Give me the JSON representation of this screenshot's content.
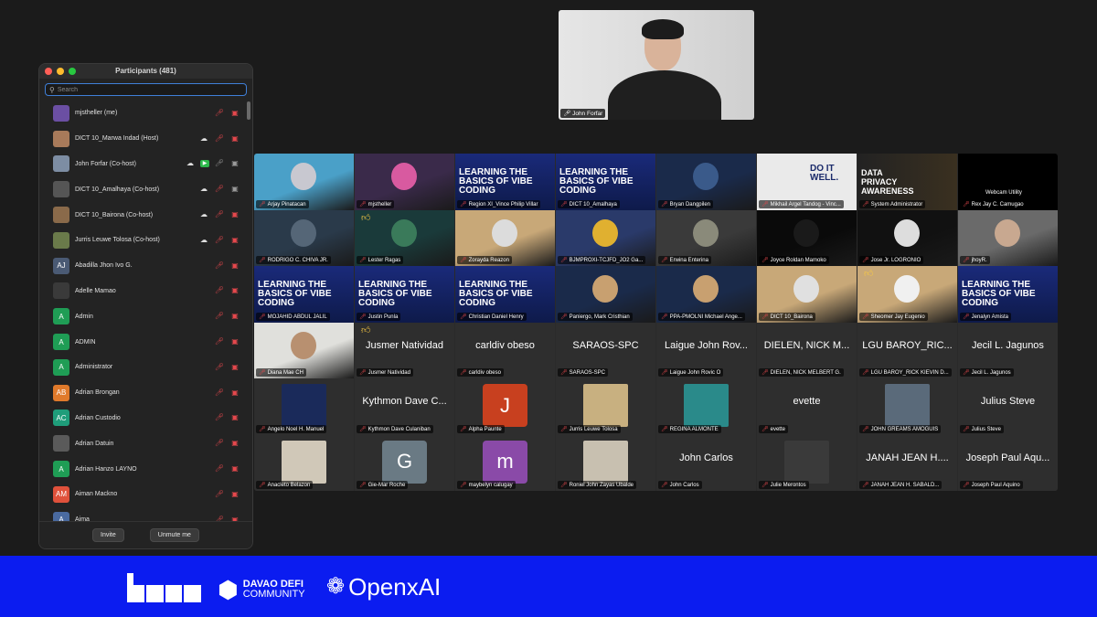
{
  "participants_panel": {
    "title": "Participants (481)",
    "search_placeholder": "Search",
    "items": [
      {
        "name": "mjstheller (me)",
        "avatar": "",
        "avatar_color": "#6b4fa3",
        "icons": [
          "mic-off-icon",
          "video-off-icon"
        ]
      },
      {
        "name": "DICT 10_Marwa Indad (Host)",
        "avatar": "",
        "avatar_color": "#a87a5a",
        "icons": [
          "cloud-icon",
          "mic-off-icon",
          "video-off-icon"
        ]
      },
      {
        "name": "John Forfar (Co-host)",
        "avatar": "",
        "avatar_color": "#7d8da3",
        "icons": [
          "cloud-icon",
          "screen-share-icon",
          "mic-icon",
          "video-icon"
        ]
      },
      {
        "name": "DICT 10_Amalhaya (Co-host)",
        "avatar": "",
        "avatar_color": "#555555",
        "icons": [
          "cloud-icon",
          "mic-off-icon",
          "video-icon"
        ]
      },
      {
        "name": "DICT 10_Bairona (Co-host)",
        "avatar": "",
        "avatar_color": "#8a6a4a",
        "icons": [
          "cloud-icon",
          "mic-off-icon",
          "video-off-icon"
        ]
      },
      {
        "name": "Jurris Leuwe Tolosa (Co-host)",
        "avatar": "",
        "avatar_color": "#6a7a4a",
        "icons": [
          "cloud-icon",
          "mic-off-icon",
          "video-off-icon"
        ]
      },
      {
        "name": "Abadilla Jhon Ivo G.",
        "avatar": "AJ",
        "avatar_color": "#4a5a74",
        "icons": [
          "mic-off-icon",
          "video-off-icon"
        ]
      },
      {
        "name": "Adelle Mamao",
        "avatar": "",
        "avatar_color": "#3a3a3a",
        "icons": [
          "mic-off-icon",
          "video-off-icon"
        ]
      },
      {
        "name": "Admin",
        "avatar": "A",
        "avatar_color": "#1f9d55",
        "icons": [
          "mic-off-icon",
          "video-off-icon"
        ]
      },
      {
        "name": "ADMIN",
        "avatar": "A",
        "avatar_color": "#1f9d55",
        "icons": [
          "mic-off-icon",
          "video-off-icon"
        ]
      },
      {
        "name": "Administrator",
        "avatar": "A",
        "avatar_color": "#1f9d55",
        "icons": [
          "mic-off-icon",
          "video-off-icon"
        ]
      },
      {
        "name": "Adrian Brongan",
        "avatar": "AB",
        "avatar_color": "#e07a2b",
        "icons": [
          "mic-off-icon",
          "video-off-icon"
        ]
      },
      {
        "name": "Adrian Custodio",
        "avatar": "AC",
        "avatar_color": "#1f9d7a",
        "icons": [
          "mic-off-icon",
          "video-off-icon"
        ]
      },
      {
        "name": "Adrian Datuin",
        "avatar": "",
        "avatar_color": "#5a5a5a",
        "icons": [
          "mic-off-icon",
          "video-off-icon"
        ]
      },
      {
        "name": "Adrian Hanzo LAYNO",
        "avatar": "A",
        "avatar_color": "#1f9d55",
        "icons": [
          "mic-off-icon",
          "video-off-icon"
        ]
      },
      {
        "name": "Aiman Mackno",
        "avatar": "AM",
        "avatar_color": "#e0513b",
        "icons": [
          "mic-off-icon",
          "video-off-icon"
        ]
      },
      {
        "name": "Aima",
        "avatar": "A",
        "avatar_color": "#4a6aa0",
        "icons": [
          "mic-off-icon",
          "video-off-icon"
        ]
      }
    ],
    "invite_label": "Invite",
    "unmute_label": "Unmute me"
  },
  "speaker": {
    "name": "John Forfar"
  },
  "gallery": [
    {
      "label": "Arjay Pinatacan",
      "style": "photo",
      "bg": "#4aa0c8",
      "accent": "#c8c8d0"
    },
    {
      "label": "mjstheller",
      "style": "photo",
      "bg": "#3a2a4a",
      "accent": "#d85aa0"
    },
    {
      "label": "Region XI_Vince Philip Villar",
      "style": "slide",
      "title": "LEARNING THE BASICS OF VIBE CODING"
    },
    {
      "label": "DICT 10_Amalhaya",
      "style": "slide",
      "title": "LEARNING THE BASICS OF VIBE CODING"
    },
    {
      "label": "Bryan Dangpilen",
      "style": "photo",
      "bg": "#1a2a4a",
      "accent": "#3a5a8a"
    },
    {
      "label": "Mikhail Argel Tandog - Vinc...",
      "style": "do",
      "title": "DO IT WELL."
    },
    {
      "label": "System Administrator",
      "style": "privacy",
      "title": "DATA PRIVACY AWARENESS"
    },
    {
      "label": "Rex Jay C. Camugao",
      "style": "webcam",
      "title": "Webcam Utility"
    },
    {
      "label": "RODRIGO C. CHIVA JR.",
      "style": "photo",
      "bg": "#2a3a4a",
      "accent": "#556677"
    },
    {
      "label": "Lester Ragas",
      "style": "photo",
      "bg": "#1a3a3a",
      "accent": "#3a7a5a",
      "thumb": true
    },
    {
      "label": "Zorayda Reazon",
      "style": "photo",
      "bg": "#c8a878",
      "accent": "#dcdcdc"
    },
    {
      "label": "BJMPROXI-TCJFD_JO2 Ga...",
      "style": "photo",
      "bg": "#2a3a6a",
      "accent": "#e0b030"
    },
    {
      "label": "Erwina Enterina",
      "style": "photo",
      "bg": "#3a3a3a",
      "accent": "#8a8a7a"
    },
    {
      "label": "Joyce Roldan Mamoko",
      "style": "photo",
      "bg": "#0a0a0a",
      "accent": "#1a1a1a"
    },
    {
      "label": "Jose Jr. LOGRONIO",
      "style": "photo",
      "bg": "#111111",
      "accent": "#dddddd"
    },
    {
      "label": "jhoyR.",
      "style": "photo",
      "bg": "#6a6a6a",
      "accent": "#c8a890"
    },
    {
      "label": "MOJAHID ABDUL JALIL",
      "style": "slide",
      "title": "LEARNING THE BASICS OF VIBE CODING"
    },
    {
      "label": "Justin Punla",
      "style": "slide",
      "title": "LEARNING THE BASICS OF VIBE CODING"
    },
    {
      "label": "Christian Daniel Henry",
      "style": "slide",
      "title": "LEARNING THE BASICS OF VIBE CODING"
    },
    {
      "label": "Paniergo, Mark Cristhian",
      "style": "photo",
      "bg": "#1a2a4a",
      "accent": "#c8a070"
    },
    {
      "label": "PPA-PMOLNI Michael Ange...",
      "style": "photo",
      "bg": "#1a2a4a",
      "accent": "#c8a070"
    },
    {
      "label": "DICT 10_Bairona",
      "style": "photo",
      "bg": "#c8a878",
      "accent": "#e0e0e0"
    },
    {
      "label": "Sheomer Jay Eugenio",
      "style": "photo",
      "bg": "#c8a878",
      "accent": "#f0f0f0",
      "thumb": true
    },
    {
      "label": "Jenalyn Amista",
      "style": "slide",
      "title": "LEARNING THE BASICS OF VIBE CODING"
    },
    {
      "label": "Diana Mae CH",
      "style": "photo",
      "bg": "#e0e0dc",
      "accent": "#b89070"
    },
    {
      "label": "Jusmer Natividad",
      "style": "name",
      "big": "Jusmer Natividad",
      "thumb": true
    },
    {
      "label": "carldiv obeso",
      "style": "name",
      "big": "carldiv obeso"
    },
    {
      "label": "SARAOS-SPC",
      "style": "name",
      "big": "SARAOS-SPC"
    },
    {
      "label": "Laigue John Rovic O",
      "style": "name",
      "big": "Laigue John Rov..."
    },
    {
      "label": "DIELEN, NICK MELBERT G.",
      "style": "name",
      "big": "DIELEN, NICK M..."
    },
    {
      "label": "LGU BAROY_RICK KIEVIN D...",
      "style": "name",
      "big": "LGU BAROY_RIC..."
    },
    {
      "label": "Jecil L. Jagunos",
      "style": "name",
      "big": "Jecil L. Jagunos"
    },
    {
      "label": "Angelo Noel H. Manuel",
      "style": "avatarphoto",
      "bg": "#1a2a5a"
    },
    {
      "label": "Kythmon Dave Culaniban",
      "style": "name",
      "big": "Kythmon Dave C..."
    },
    {
      "label": "Alpha Paunte",
      "style": "letter",
      "letter": "J",
      "bg": "#c8401f"
    },
    {
      "label": "Jurris Leuwe Tolosa",
      "style": "avatarphoto",
      "bg": "#c8b080"
    },
    {
      "label": "REGINA ALMONTE",
      "style": "avatarphoto",
      "bg": "#2a8a8a"
    },
    {
      "label": "evette",
      "style": "name",
      "big": "evette"
    },
    {
      "label": "JOHN GREAMS AMOGUIS",
      "style": "avatarphoto",
      "bg": "#5a6a7a"
    },
    {
      "label": "Julius Steve",
      "style": "name",
      "big": "Julius Steve"
    },
    {
      "label": "Anacleto Belazon",
      "style": "avatarphoto",
      "bg": "#d0c8b8"
    },
    {
      "label": "Gie-Mar Roche",
      "style": "letter",
      "letter": "G",
      "bg": "#6a7a84"
    },
    {
      "label": "maybelyn calugay",
      "style": "letter",
      "letter": "m",
      "bg": "#8a4aa8"
    },
    {
      "label": "Roniel John Zayas Ubalde",
      "style": "avatarphoto",
      "bg": "#c8c0b0"
    },
    {
      "label": "John Carlos",
      "style": "name",
      "big": "John Carlos"
    },
    {
      "label": "Julie Merontos",
      "style": "avatarphoto",
      "bg": "#3a3a3a"
    },
    {
      "label": "JANAH JEAN H. SABALD...",
      "style": "name",
      "big": "JANAH JEAN H...."
    },
    {
      "label": "Joseph Paul Aquino",
      "style": "name",
      "big": "Joseph Paul Aqu..."
    }
  ],
  "banner": {
    "ddc_line1": "DAVAO DEFI",
    "ddc_line2": "COMMUNITY",
    "openx_name": "OpenxAI",
    "bg_color": "#0b1cf0"
  }
}
